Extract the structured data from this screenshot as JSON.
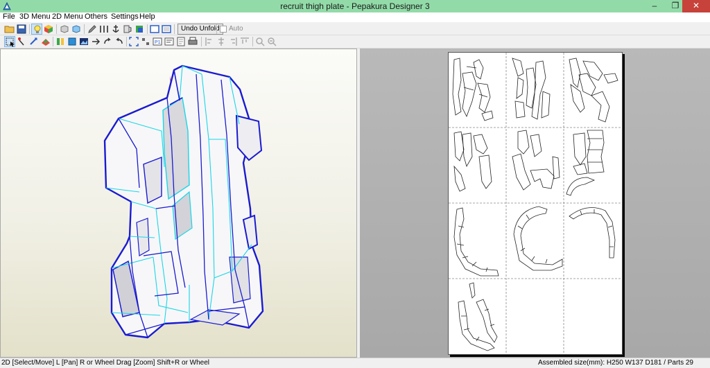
{
  "window": {
    "title": "recruit thigh plate - Pepakura Designer 3",
    "minimize": "‒",
    "maximize": "❐",
    "close": "✕"
  },
  "menu": [
    "File",
    "3D Menu",
    "2D Menu",
    "Others",
    "Settings",
    "Help"
  ],
  "toolbar": {
    "undo_unfold": "Undo Unfold",
    "auto": "Auto"
  },
  "status": {
    "hint": "2D [Select/Move] L [Pan] R or Wheel Drag [Zoom] Shift+R or Wheel",
    "assembled": "Assembled size(mm): H250 W137 D181 / Parts 29"
  },
  "colors": {
    "titlebar": "#92dba8",
    "model_outline": "#1a1ad0",
    "fold_line": "#19d6e6",
    "cut_edge": "#d41c1c"
  }
}
